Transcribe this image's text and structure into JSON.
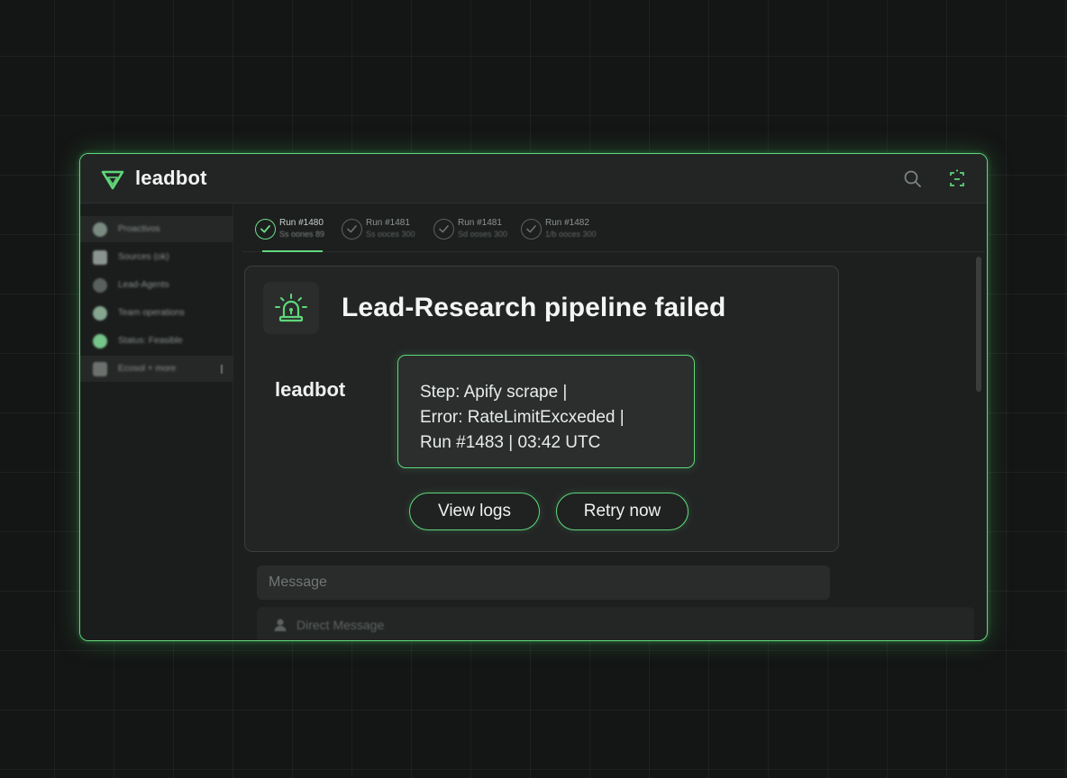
{
  "app": {
    "name": "leadbot",
    "accent_color": "#5fd77a"
  },
  "topbar": {
    "logo_icon": "triangle-logo-icon",
    "search_icon": "search-icon",
    "settings_icon": "settings-icon"
  },
  "sidebar": {
    "items": [
      {
        "label": "Proactivos",
        "icon": "gear-icon",
        "color": "#7a8c82"
      },
      {
        "label": "Sources (ok)",
        "icon": "database-icon",
        "color": "#8a9490"
      },
      {
        "label": "Lead-Agents",
        "icon": "cloud-icon",
        "color": "#5a605d"
      },
      {
        "label": "Team operations",
        "icon": "team-icon",
        "color": "#86a68f"
      },
      {
        "label": "Status: Feasible",
        "icon": "status-icon",
        "color": "#76c58a"
      },
      {
        "label": "Ecosol + more",
        "icon": "monitor-icon",
        "color": "#6c716e"
      }
    ]
  },
  "tabs": [
    {
      "title": "Run #1480",
      "subtitle": "Ss oones 89",
      "active": true
    },
    {
      "title": "Run #1481",
      "subtitle": "Ss ooces 300",
      "active": false
    },
    {
      "title": "Run #1481",
      "subtitle": "Sd ooses 300",
      "active": false
    },
    {
      "title": "Run #1482",
      "subtitle": "1/b ooces 300",
      "active": false
    }
  ],
  "alert": {
    "icon": "siren-alarm-icon",
    "title": "Lead-Research pipeline failed",
    "sender": "leadbot",
    "message_lines": [
      "Step: Apify scrape |",
      "Error: RateLimitExcxeded |",
      "Run #1483 | 03:42 UTC"
    ],
    "view_logs_label": "View logs",
    "retry_label": "Retry now"
  },
  "composer": {
    "placeholder": "Message",
    "direct_message_placeholder": "Direct Message"
  }
}
